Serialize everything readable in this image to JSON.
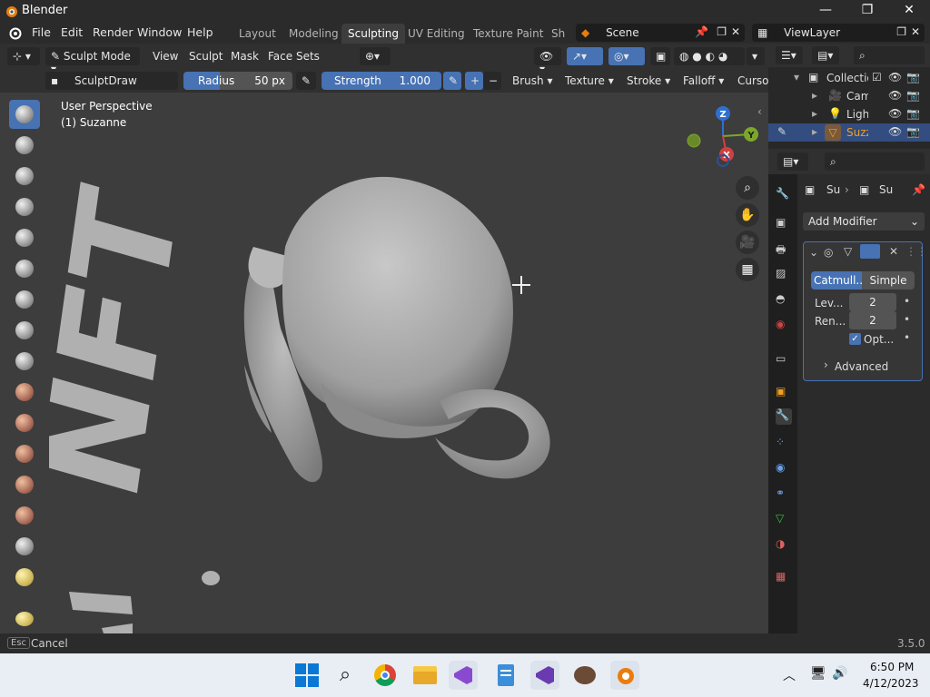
{
  "titlebar": {
    "app_name": "Blender",
    "minimize": "—",
    "maximize": "❐",
    "close": "✕"
  },
  "menu": [
    "File",
    "Edit",
    "Render",
    "Window",
    "Help"
  ],
  "workspaces": [
    "Layout",
    "Modeling",
    "Sculpting",
    "UV Editing",
    "Texture Paint",
    "Sh"
  ],
  "active_workspace": "Sculpting",
  "scene": "Scene",
  "view_layer": "ViewLayer",
  "header2": {
    "mode": "Sculpt Mode",
    "menus": [
      "View",
      "Sculpt",
      "Mask",
      "Face Sets"
    ]
  },
  "header3": {
    "brush_name": "SculptDraw",
    "radius_label": "Radius",
    "radius_value": "50 px",
    "strength_label": "Strength",
    "strength_value": "1.000",
    "plus": "+",
    "minus": "−",
    "dropdowns": [
      "Brush",
      "Texture",
      "Stroke",
      "Falloff",
      "Cursor"
    ]
  },
  "viewport": {
    "perspective": "User Perspective",
    "object": "(1) Suzanne",
    "text3d_line1": "NFT",
    "gizmo": {
      "z": "Z",
      "y": "Y",
      "x": "X"
    }
  },
  "outliner": {
    "items": [
      {
        "label": "Collectio"
      },
      {
        "label": "Cam"
      },
      {
        "label": "Ligh"
      },
      {
        "label": "Suzz"
      }
    ]
  },
  "properties": {
    "breadcrumb": [
      "Su",
      "Su"
    ],
    "add_modifier": "Add Modifier",
    "modifier_tabs": [
      "Catmull...",
      "Simple"
    ],
    "levels_label": "Lev...",
    "levels_value": "2",
    "render_label": "Ren...",
    "render_value": "2",
    "optimal_label": "Opt...",
    "advanced_label": "Advanced"
  },
  "status": {
    "key": "Esc",
    "action": "Cancel",
    "version": "3.5.0"
  },
  "taskbar": {
    "time": "6:50 PM",
    "date": "4/12/2023"
  }
}
